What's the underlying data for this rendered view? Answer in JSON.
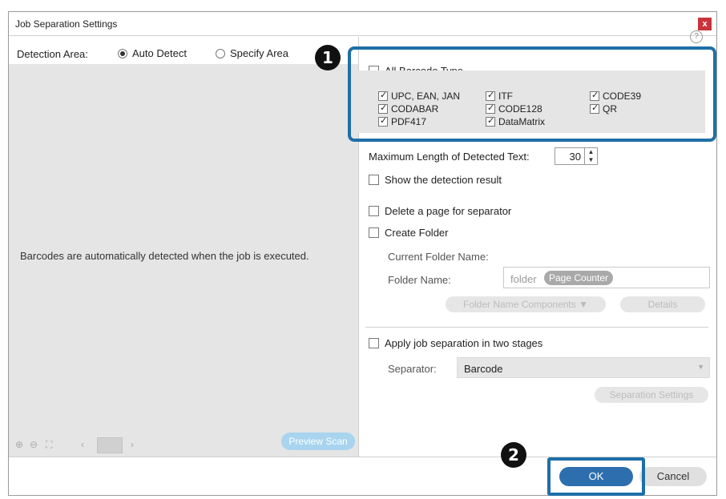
{
  "window": {
    "title": "Job Separation Settings",
    "close_glyph": "x"
  },
  "detection": {
    "label": "Detection Area:",
    "auto_label": "Auto Detect",
    "specify_label": "Specify Area",
    "preview_message": "Barcodes are automatically detected when the job is executed.",
    "preview_button": "Preview Scan"
  },
  "toolbar": {
    "zoom_in": "⊕",
    "zoom_out": "⊖",
    "fit": "⛶",
    "prev": "‹",
    "next": "›"
  },
  "barcodes": {
    "all_label": "All Barcode Type",
    "types": [
      {
        "label": "UPC, EAN, JAN",
        "checked": true
      },
      {
        "label": "ITF",
        "checked": true
      },
      {
        "label": "CODE39",
        "checked": true
      },
      {
        "label": "CODABAR",
        "checked": true
      },
      {
        "label": "CODE128",
        "checked": true
      },
      {
        "label": "QR",
        "checked": true
      },
      {
        "label": "PDF417",
        "checked": true
      },
      {
        "label": "DataMatrix",
        "checked": true
      }
    ]
  },
  "max_length": {
    "label": "Maximum Length of Detected Text:",
    "value": "30"
  },
  "options": {
    "show_result": "Show the detection result",
    "delete_page": "Delete a page for separator",
    "create_folder": "Create Folder"
  },
  "folder": {
    "current_label": "Current Folder Name:",
    "name_label": "Folder Name:",
    "name_prefix": "folder",
    "chip": "Page Counter",
    "components_button": "Folder Name Components ▼",
    "details_button": "Details"
  },
  "two_stage": {
    "label": "Apply job separation in two stages",
    "separator_label": "Separator:",
    "separator_value": "Barcode",
    "settings_button": "Separation Settings"
  },
  "buttons": {
    "ok": "OK",
    "cancel": "Cancel"
  },
  "callouts": {
    "one": "1",
    "two": "2"
  },
  "colors": {
    "accent": "#1e6fa8",
    "ok": "#2d6fae",
    "close": "#c7353a"
  }
}
